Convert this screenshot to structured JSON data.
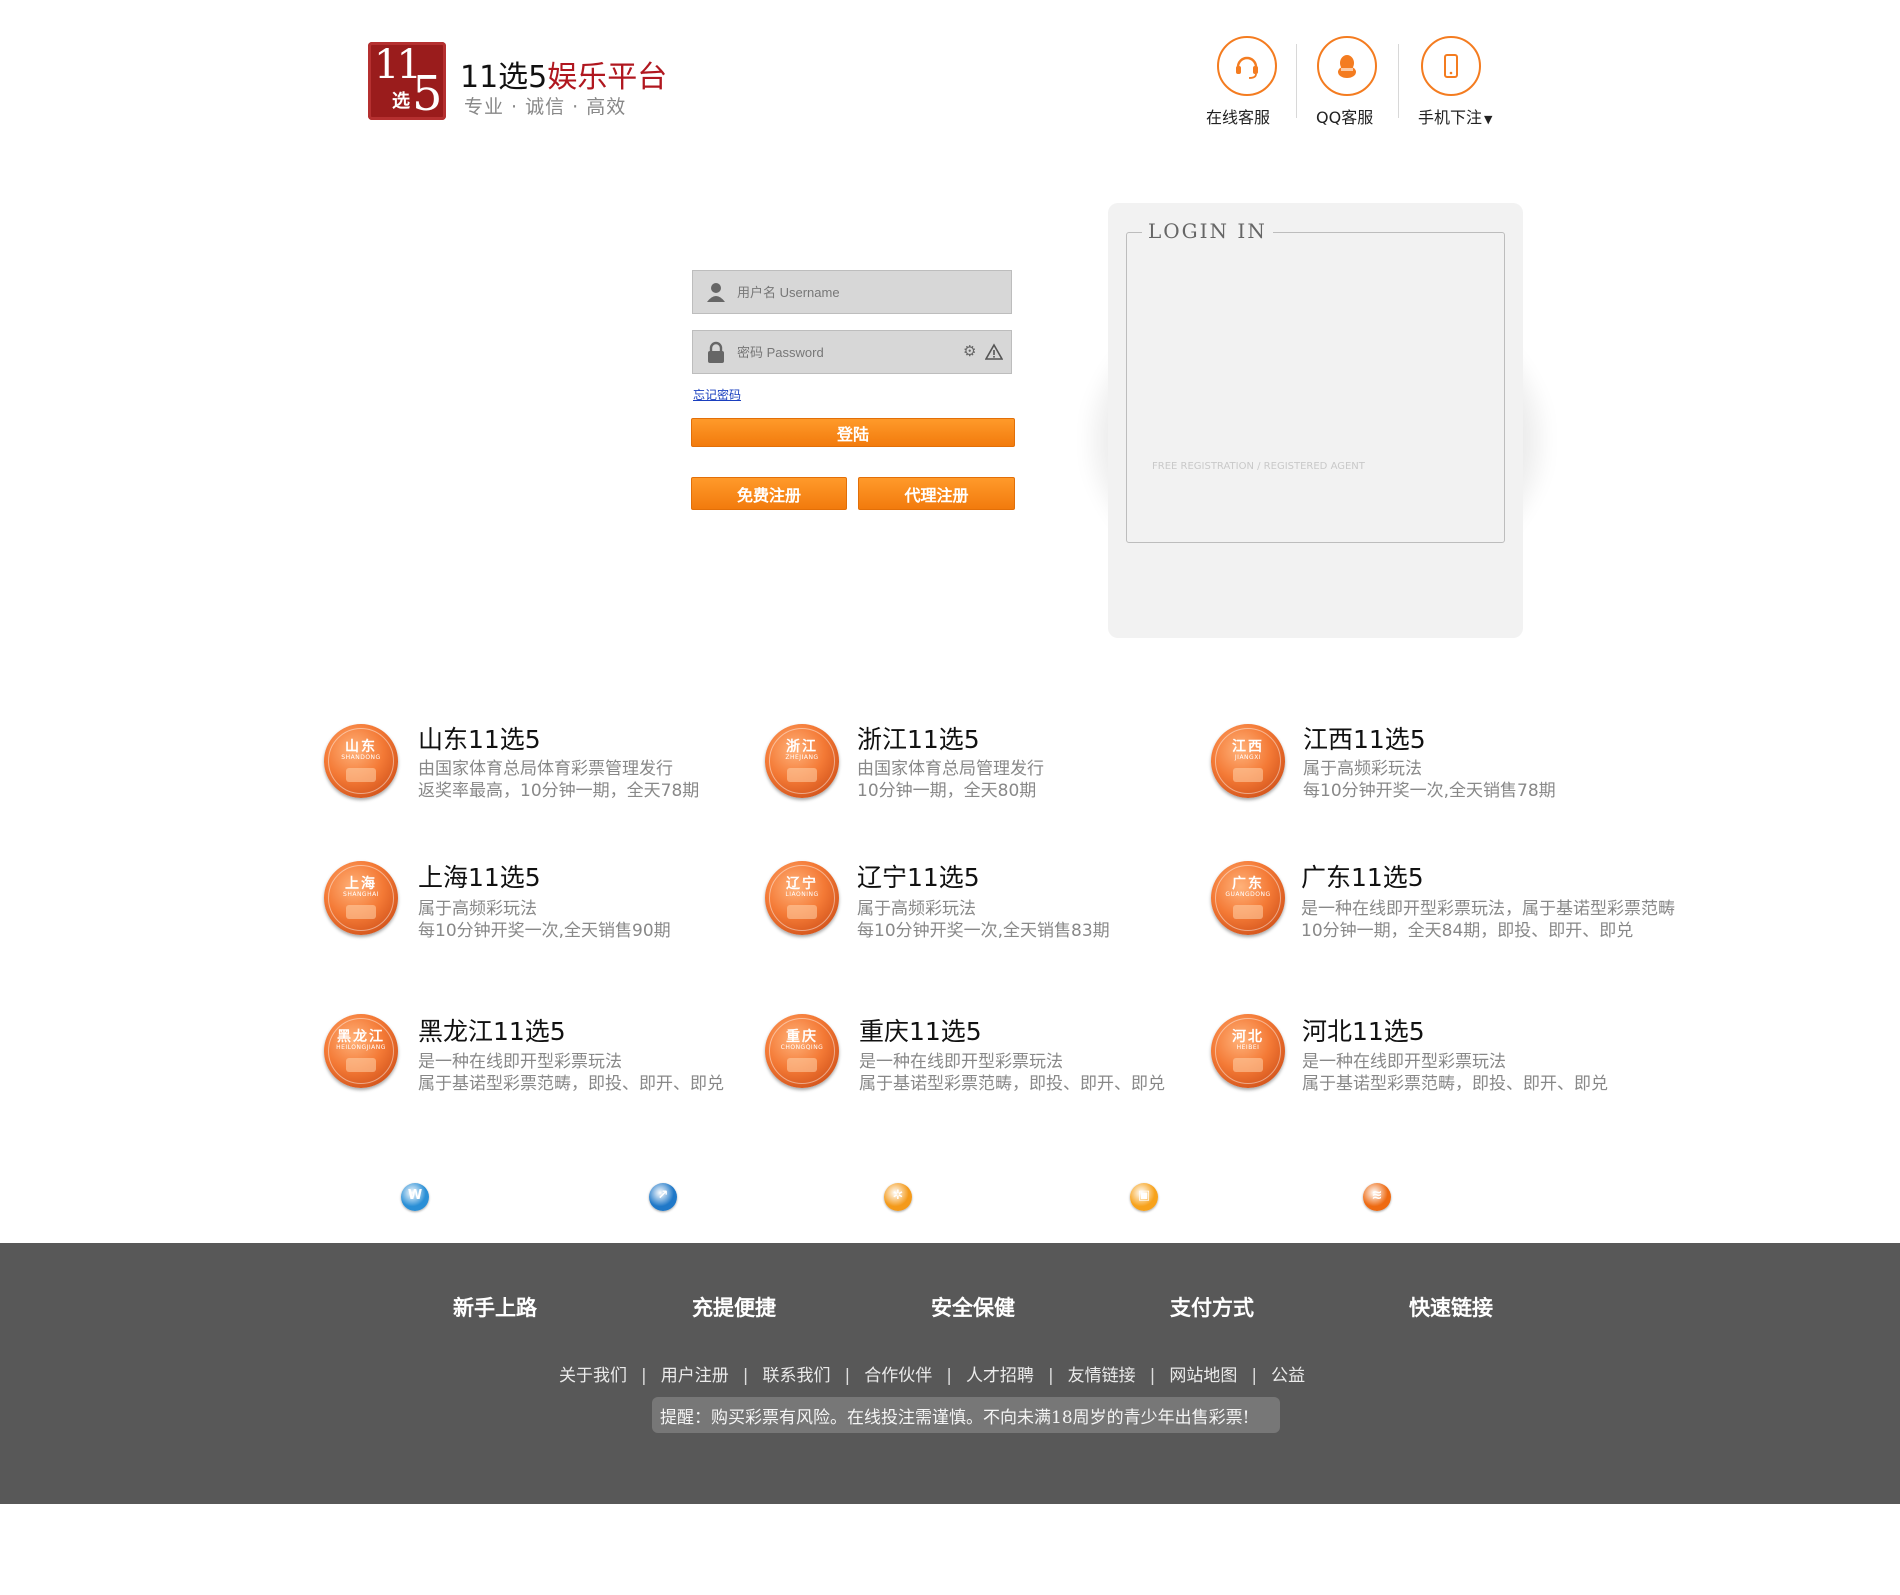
{
  "header": {
    "logo": {
      "top": "11",
      "mid": "选",
      "five": "5"
    },
    "brand_main": "11选5",
    "brand_highlight": "娱乐平台",
    "slogan": "专业 · 诚信 · 高效",
    "services": [
      {
        "label": "在线客服",
        "icon": "headset-icon"
      },
      {
        "label": "QQ客服",
        "icon": "qq-penguin-icon"
      },
      {
        "label": "手机下注",
        "icon": "mobile-phone-icon"
      }
    ]
  },
  "login": {
    "username_placeholder": "用户名 Username",
    "password_placeholder": "密码 Password",
    "forgot_password": "忘记密码",
    "login_button": "登陆",
    "register_button": "免费注册",
    "agent_register_button": "代理注册",
    "panel_title": "LOGIN IN",
    "panel_links": "FREE REGISTRATION   /   REGISTERED AGENT"
  },
  "lotteries": [
    {
      "cn": "山东",
      "py": "SHANDONG",
      "title": "山东11选5",
      "desc1": "由国家体育总局体育彩票管理发行",
      "desc2": "返奖率最高，10分钟一期，全天78期"
    },
    {
      "cn": "浙江",
      "py": "ZHEJIANG",
      "title": "浙江11选5",
      "desc1": "由国家体育总局管理发行",
      "desc2": "10分钟一期，全天80期"
    },
    {
      "cn": "江西",
      "py": "JIANGXI",
      "title": "江西11选5",
      "desc1": "属于高频彩玩法",
      "desc2": "每10分钟开奖一次,全天销售78期"
    },
    {
      "cn": "上海",
      "py": "SHANGHAI",
      "title": "上海11选5",
      "desc1": "属于高频彩玩法",
      "desc2": "每10分钟开奖一次,全天销售90期"
    },
    {
      "cn": "辽宁",
      "py": "LIAONING",
      "title": "辽宁11选5",
      "desc1": "属于高频彩玩法",
      "desc2": "每10分钟开奖一次,全天销售83期"
    },
    {
      "cn": "广东",
      "py": "GUANGDONG",
      "title": "广东11选5",
      "desc1": "是一种在线即开型彩票玩法，属于基诺型彩票范畴",
      "desc2": "10分钟一期，全天84期，即投、即开、即兑"
    },
    {
      "cn": "黑龙江",
      "py": "HEILONGJIANG",
      "title": "黑龙江11选5",
      "desc1": "是一种在线即开型彩票玩法",
      "desc2": "属于基诺型彩票范畴，即投、即开、即兑"
    },
    {
      "cn": "重庆",
      "py": "CHONGQING",
      "title": "重庆11选5",
      "desc1": "是一种在线即开型彩票玩法",
      "desc2": "属于基诺型彩票范畴，即投、即开、即兑"
    },
    {
      "cn": "河北",
      "py": "HEIBEI",
      "title": "河北11选5",
      "desc1": "是一种在线即开型彩票玩法",
      "desc2": "属于基诺型彩票范畴，即投、即开、即兑"
    }
  ],
  "social": [
    {
      "icon": "weibo-icon",
      "glyph": "W",
      "color": "#2a8fd6"
    },
    {
      "icon": "compass-icon",
      "glyph": "↗",
      "color": "#1f78c8"
    },
    {
      "icon": "star-badge-icon",
      "glyph": "✲",
      "color": "#f49a1a"
    },
    {
      "icon": "chat-icon",
      "glyph": "▣",
      "color": "#f7a21b"
    },
    {
      "icon": "rss-icon",
      "glyph": "≋",
      "color": "#ee6a12"
    }
  ],
  "footer": {
    "headings": [
      "新手上路",
      "充提便捷",
      "安全保健",
      "支付方式",
      "快速链接"
    ],
    "links": [
      "关于我们",
      "用户注册",
      "联系我们",
      "合作伙伴",
      "人才招聘",
      "友情链接",
      "网站地图",
      "公益"
    ],
    "link_separator": "|",
    "notice": "提醒：购买彩票有风险。在线投注需谨慎。不向未满18周岁的青少年出售彩票!"
  }
}
